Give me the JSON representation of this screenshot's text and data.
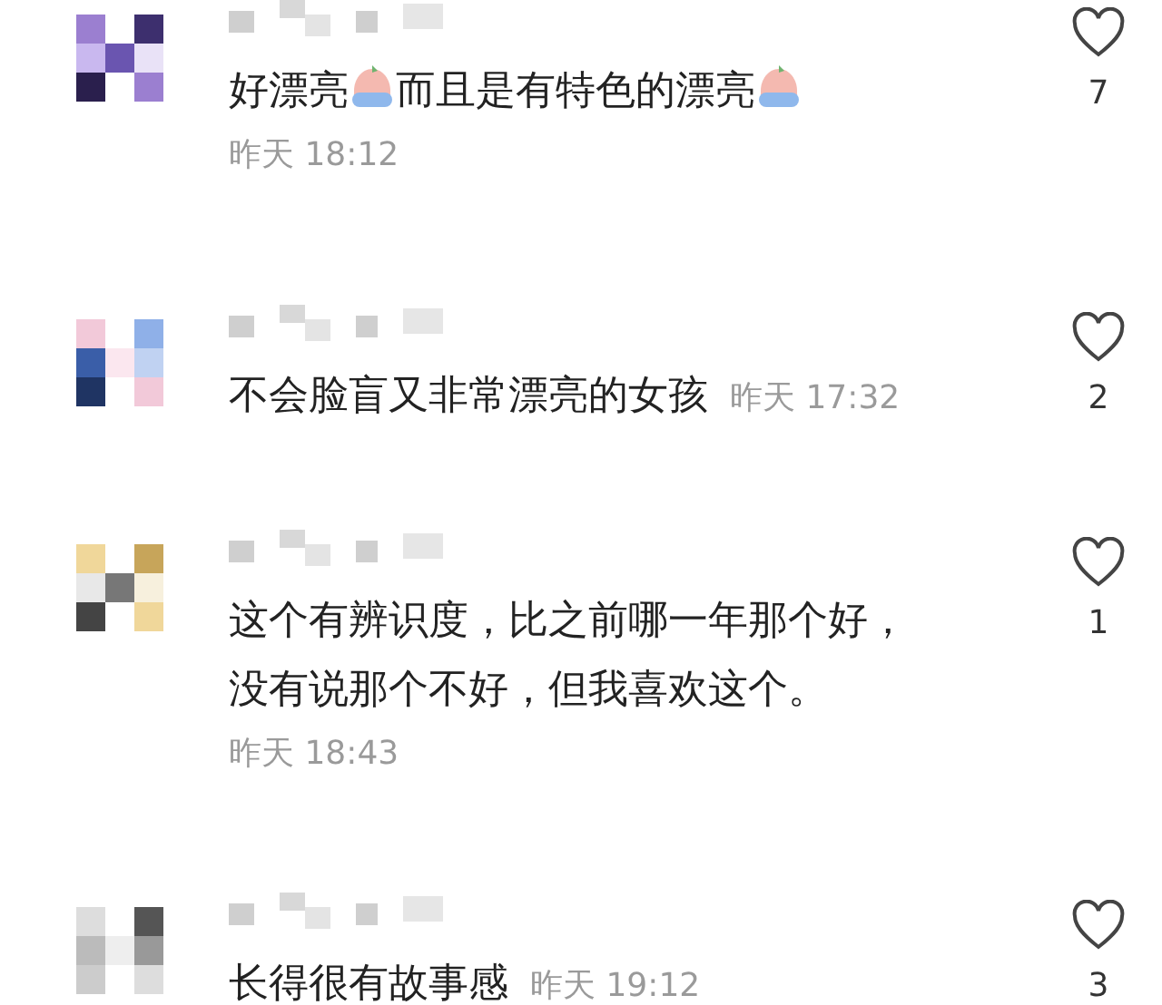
{
  "comments": [
    {
      "kind": "block_time",
      "lines": [
        [
          {
            "kind": "text",
            "text": "好漂亮"
          },
          {
            "kind": "emoji"
          },
          {
            "kind": "text",
            "text": "而且是有特色的漂亮"
          },
          {
            "kind": "emoji"
          }
        ]
      ],
      "time": "昨天 18:12",
      "likes": "7"
    },
    {
      "kind": "inline_time",
      "lines": [
        [
          {
            "kind": "text",
            "text": "不会脸盲又非常漂亮的女孩"
          }
        ]
      ],
      "time": "昨天 17:32",
      "likes": "2"
    },
    {
      "kind": "block_time",
      "lines": [
        [
          {
            "kind": "text",
            "text": "这个有辨识度，比之前哪一年那个好，"
          }
        ],
        [
          {
            "kind": "text",
            "text": "没有说那个不好，但我喜欢这个。"
          }
        ]
      ],
      "time": "昨天 18:43",
      "likes": "1"
    },
    {
      "kind": "inline_time",
      "lines": [
        [
          {
            "kind": "text",
            "text": "长得很有故事感"
          }
        ]
      ],
      "time": "昨天 19:12",
      "likes": "3"
    }
  ]
}
